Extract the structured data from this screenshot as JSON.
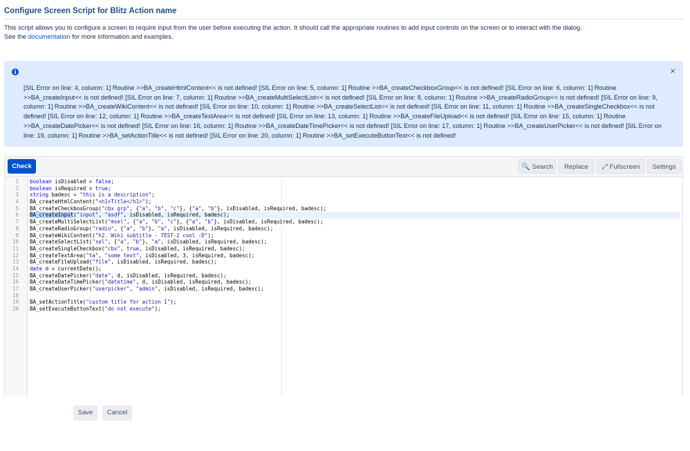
{
  "header": {
    "title": "Configure Screen Script for Blitz Action name",
    "intro_line1": "This script allows you to configure a screen to require input from the user before executing the action. It should call the appropriate routines to add input controls on the screen or to interact with the dialog.",
    "intro_see": "See the ",
    "intro_link": "documentation",
    "intro_rest": " for more information and examples."
  },
  "error_message": {
    "icon": "info-icon",
    "close_symbol": "×",
    "text": "[SIL Error on line: 4, column: 1] Routine >>BA_createHtmlContent<< is not defined! [SIL Error on line: 5, column: 1] Routine >>BA_createCheckboxGroup<< is not defined! [SIL Error on line: 6, column: 1] Routine >>BA_createInput<< is not defined! [SIL Error on line: 7, column: 1] Routine >>BA_createMultiSelectList<< is not defined! [SIL Error on line: 8, column: 1] Routine >>BA_createRadioGroup<< is not defined! [SIL Error on line: 9, column: 1] Routine >>BA_createWikiContent<< is not defined! [SIL Error on line: 10, column: 1] Routine >>BA_createSelectList<< is not defined! [SIL Error on line: 11, column: 1] Routine >>BA_createSingleCheckbox<< is not defined! [SIL Error on line: 12, column: 1] Routine >>BA_createTextArea<< is not defined! [SIL Error on line: 13, column: 1] Routine >>BA_createFileUpload<< is not defined! [SIL Error on line: 15, column: 1] Routine >>BA_createDatePicker<< is not defined! [SIL Error on line: 16, column: 1] Routine >>BA_createDateTimePicker<< is not defined! [SIL Error on line: 17, column: 1] Routine >>BA_createUserPicker<< is not defined! [SIL Error on line: 19, column: 1] Routine >>BA_setActionTitle<< is not defined! [SIL Error on line: 20, column: 1] Routine >>BA_setExecuteButtonText<< is not defined!"
  },
  "toolbar": {
    "check_label": "Check",
    "search_label": "Search",
    "replace_label": "Replace",
    "fullscreen_label": "Fullscreen",
    "settings_label": "Settings",
    "search_icon": "🔍",
    "fullscreen_icon": "⤢"
  },
  "editor": {
    "active_line": 6,
    "lines": [
      "boolean isDisabled = false;",
      "boolean isRequired = true;",
      "string badesc = \"this is a description\";",
      "BA_createHtmlContent(\"<h1>Title</h1>\");",
      "BA_createCheckboxGroup(\"cbx grp\", {\"a\", \"b\", \"c\"}, {\"a\", \"b\"}, isDisabled, isRequired, badesc);",
      "BA_createInput(\"input\", \"asdf\", isDisabled, isRequired, badesc);",
      "BA_createMultiSelectList(\"msel\", {\"a\", \"b\", \"c\"}, {\"a\", \"b\"}, isDisabled, isRequired, badesc);",
      "BA_createRadioGroup(\"radio\", {\"a\", \"b\"}, \"a\", isDisabled, isRequired, badesc);",
      "BA_createWikiContent(\"h2. Wiki subtitle - TEST-2 cool :D\");",
      "BA_createSelectList(\"sel\", {\"a\", \"b\"}, \"a\", isDisabled, isRequired, badesc);",
      "BA_createSingleCheckbox(\"cbx\", true, isDisabled, isRequired, badesc);",
      "BA_createTextArea(\"ta\", \"some text\", isDisabled, 3, isRequired, badesc);",
      "BA_createFileUpload(\"file\", isDisabled, isRequired, badesc);",
      "date d = currentDate();",
      "BA_createDatePicker(\"date\", d, isDisabled, isRequired, badesc);",
      "BA_createDateTimePicker(\"datetime\", d, isDisabled, isRequired, badesc);",
      "BA_createUserPicker(\"userpicker\", \"admin\", isDisabled, isRequired, badesc);",
      "",
      "BA_setActionTitle(\"custom title for action 1\");",
      "BA_setExecuteButtonText(\"do not execute\");"
    ]
  },
  "footer": {
    "save_label": "Save",
    "cancel_label": "Cancel"
  }
}
